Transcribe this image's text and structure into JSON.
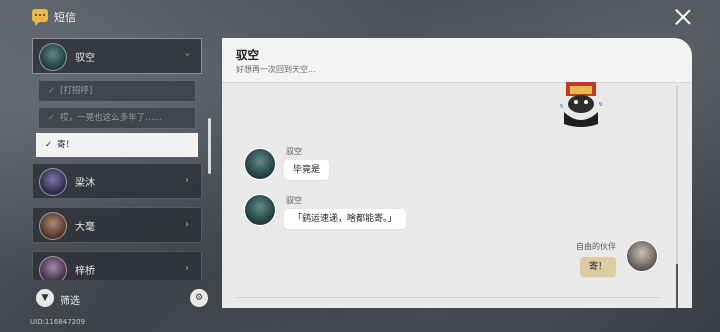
{
  "app": {
    "title": "短信"
  },
  "sidebar": {
    "contacts": [
      {
        "name": "驭空",
        "expanded": true,
        "color": "#2f5a57"
      },
      {
        "name": "梁沐",
        "color": "#4a4470"
      },
      {
        "name": "大毫",
        "color": "#6a5040"
      },
      {
        "name": "梓桥",
        "color": "#6a4a6a"
      }
    ],
    "replies": [
      {
        "check": "✓",
        "text": "[打招呼]"
      },
      {
        "check": "✓",
        "text": "哎，一晃也这么多年了……"
      },
      {
        "check": "✓",
        "text": "寄！",
        "active": true
      }
    ]
  },
  "footer": {
    "filter_label": "筛选",
    "uid": "UID:116847209"
  },
  "chat": {
    "name": "驭空",
    "signature": "好想再一次回到天空...",
    "messages": [
      {
        "sender": "驭空",
        "text": "毕竟是",
        "mine": false
      },
      {
        "sender": "驭空",
        "text": "「鹞运速递，啥都能寄。」",
        "mine": false
      },
      {
        "sender": "自由的伙伴",
        "text": "寄！",
        "mine": true
      }
    ]
  },
  "colors": {
    "panel_bg": "#e9e9ea",
    "my_bubble": "#dccaa2",
    "app_icon": "#e8b84a"
  }
}
